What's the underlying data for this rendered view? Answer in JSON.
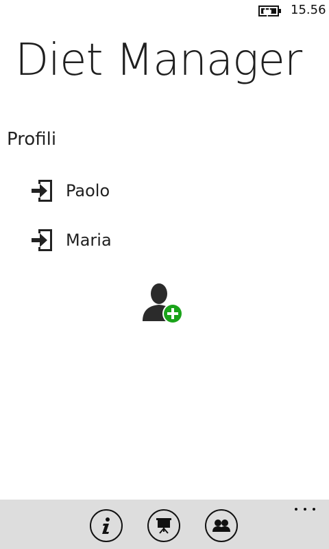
{
  "status_bar": {
    "time": "15.56",
    "battery_icon": "battery-charging-icon"
  },
  "app": {
    "title": "Diet Manager"
  },
  "profiles": {
    "header": "Profili",
    "items": [
      {
        "name": "Paolo",
        "icon": "login-icon"
      },
      {
        "name": "Maria",
        "icon": "login-icon"
      }
    ],
    "add_icon": "add-user-icon"
  },
  "app_bar": {
    "buttons": [
      {
        "icon": "info-icon"
      },
      {
        "icon": "presentation-icon"
      },
      {
        "icon": "users-icon"
      }
    ],
    "more_icon": "ellipsis-icon"
  },
  "colors": {
    "accent_green": "#1aa31a",
    "app_bar_bg": "#dddddd",
    "text": "#1f1f1f"
  }
}
